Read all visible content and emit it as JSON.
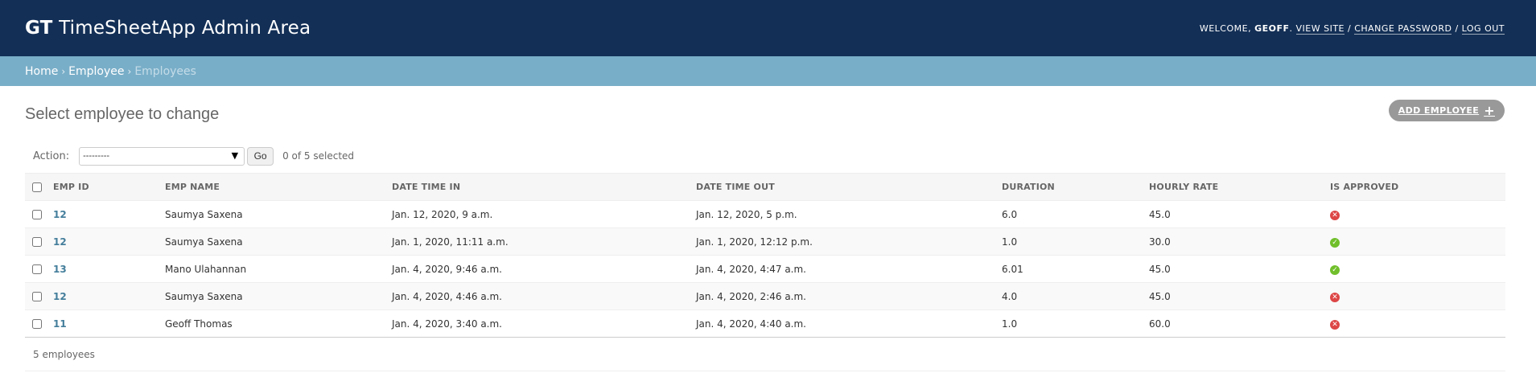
{
  "header": {
    "brand_bold": "GT",
    "brand_rest": "TimeSheetApp Admin Area",
    "welcome_prefix": "WELCOME,",
    "username": "GEOFF",
    "links": [
      "VIEW SITE",
      "CHANGE PASSWORD",
      "LOG OUT"
    ]
  },
  "breadcrumbs": [
    "Home",
    "Employee",
    "Employees"
  ],
  "page": {
    "title": "Select employee to change",
    "add_button": "ADD EMPLOYEE"
  },
  "actions": {
    "label": "Action:",
    "select_value": "---------",
    "go_label": "Go",
    "selected_count": "0 of 5 selected"
  },
  "table": {
    "columns": [
      "EMP ID",
      "EMP NAME",
      "DATE TIME IN",
      "DATE TIME OUT",
      "DURATION",
      "HOURLY RATE",
      "IS APPROVED"
    ],
    "rows": [
      {
        "emp_id": "12",
        "emp_name": "Saumya Saxena",
        "time_in": "Jan. 12, 2020, 9 a.m.",
        "time_out": "Jan. 12, 2020, 5 p.m.",
        "duration": "6.0",
        "hourly_rate": "45.0",
        "approved": false
      },
      {
        "emp_id": "12",
        "emp_name": "Saumya Saxena",
        "time_in": "Jan. 1, 2020, 11:11 a.m.",
        "time_out": "Jan. 1, 2020, 12:12 p.m.",
        "duration": "1.0",
        "hourly_rate": "30.0",
        "approved": true
      },
      {
        "emp_id": "13",
        "emp_name": "Mano Ulahannan",
        "time_in": "Jan. 4, 2020, 9:46 a.m.",
        "time_out": "Jan. 4, 2020, 4:47 a.m.",
        "duration": "6.01",
        "hourly_rate": "45.0",
        "approved": true
      },
      {
        "emp_id": "12",
        "emp_name": "Saumya Saxena",
        "time_in": "Jan. 4, 2020, 4:46 a.m.",
        "time_out": "Jan. 4, 2020, 2:46 a.m.",
        "duration": "4.0",
        "hourly_rate": "45.0",
        "approved": false
      },
      {
        "emp_id": "11",
        "emp_name": "Geoff Thomas",
        "time_in": "Jan. 4, 2020, 3:40 a.m.",
        "time_out": "Jan. 4, 2020, 4:40 a.m.",
        "duration": "1.0",
        "hourly_rate": "60.0",
        "approved": false
      }
    ]
  },
  "paginator": "5 employees",
  "colors": {
    "header_bg": "#132f56",
    "breadcrumb_bg": "#79aec8",
    "link": "#447e9b",
    "approved_yes": "#70bf2b",
    "approved_no": "#dd4646"
  }
}
